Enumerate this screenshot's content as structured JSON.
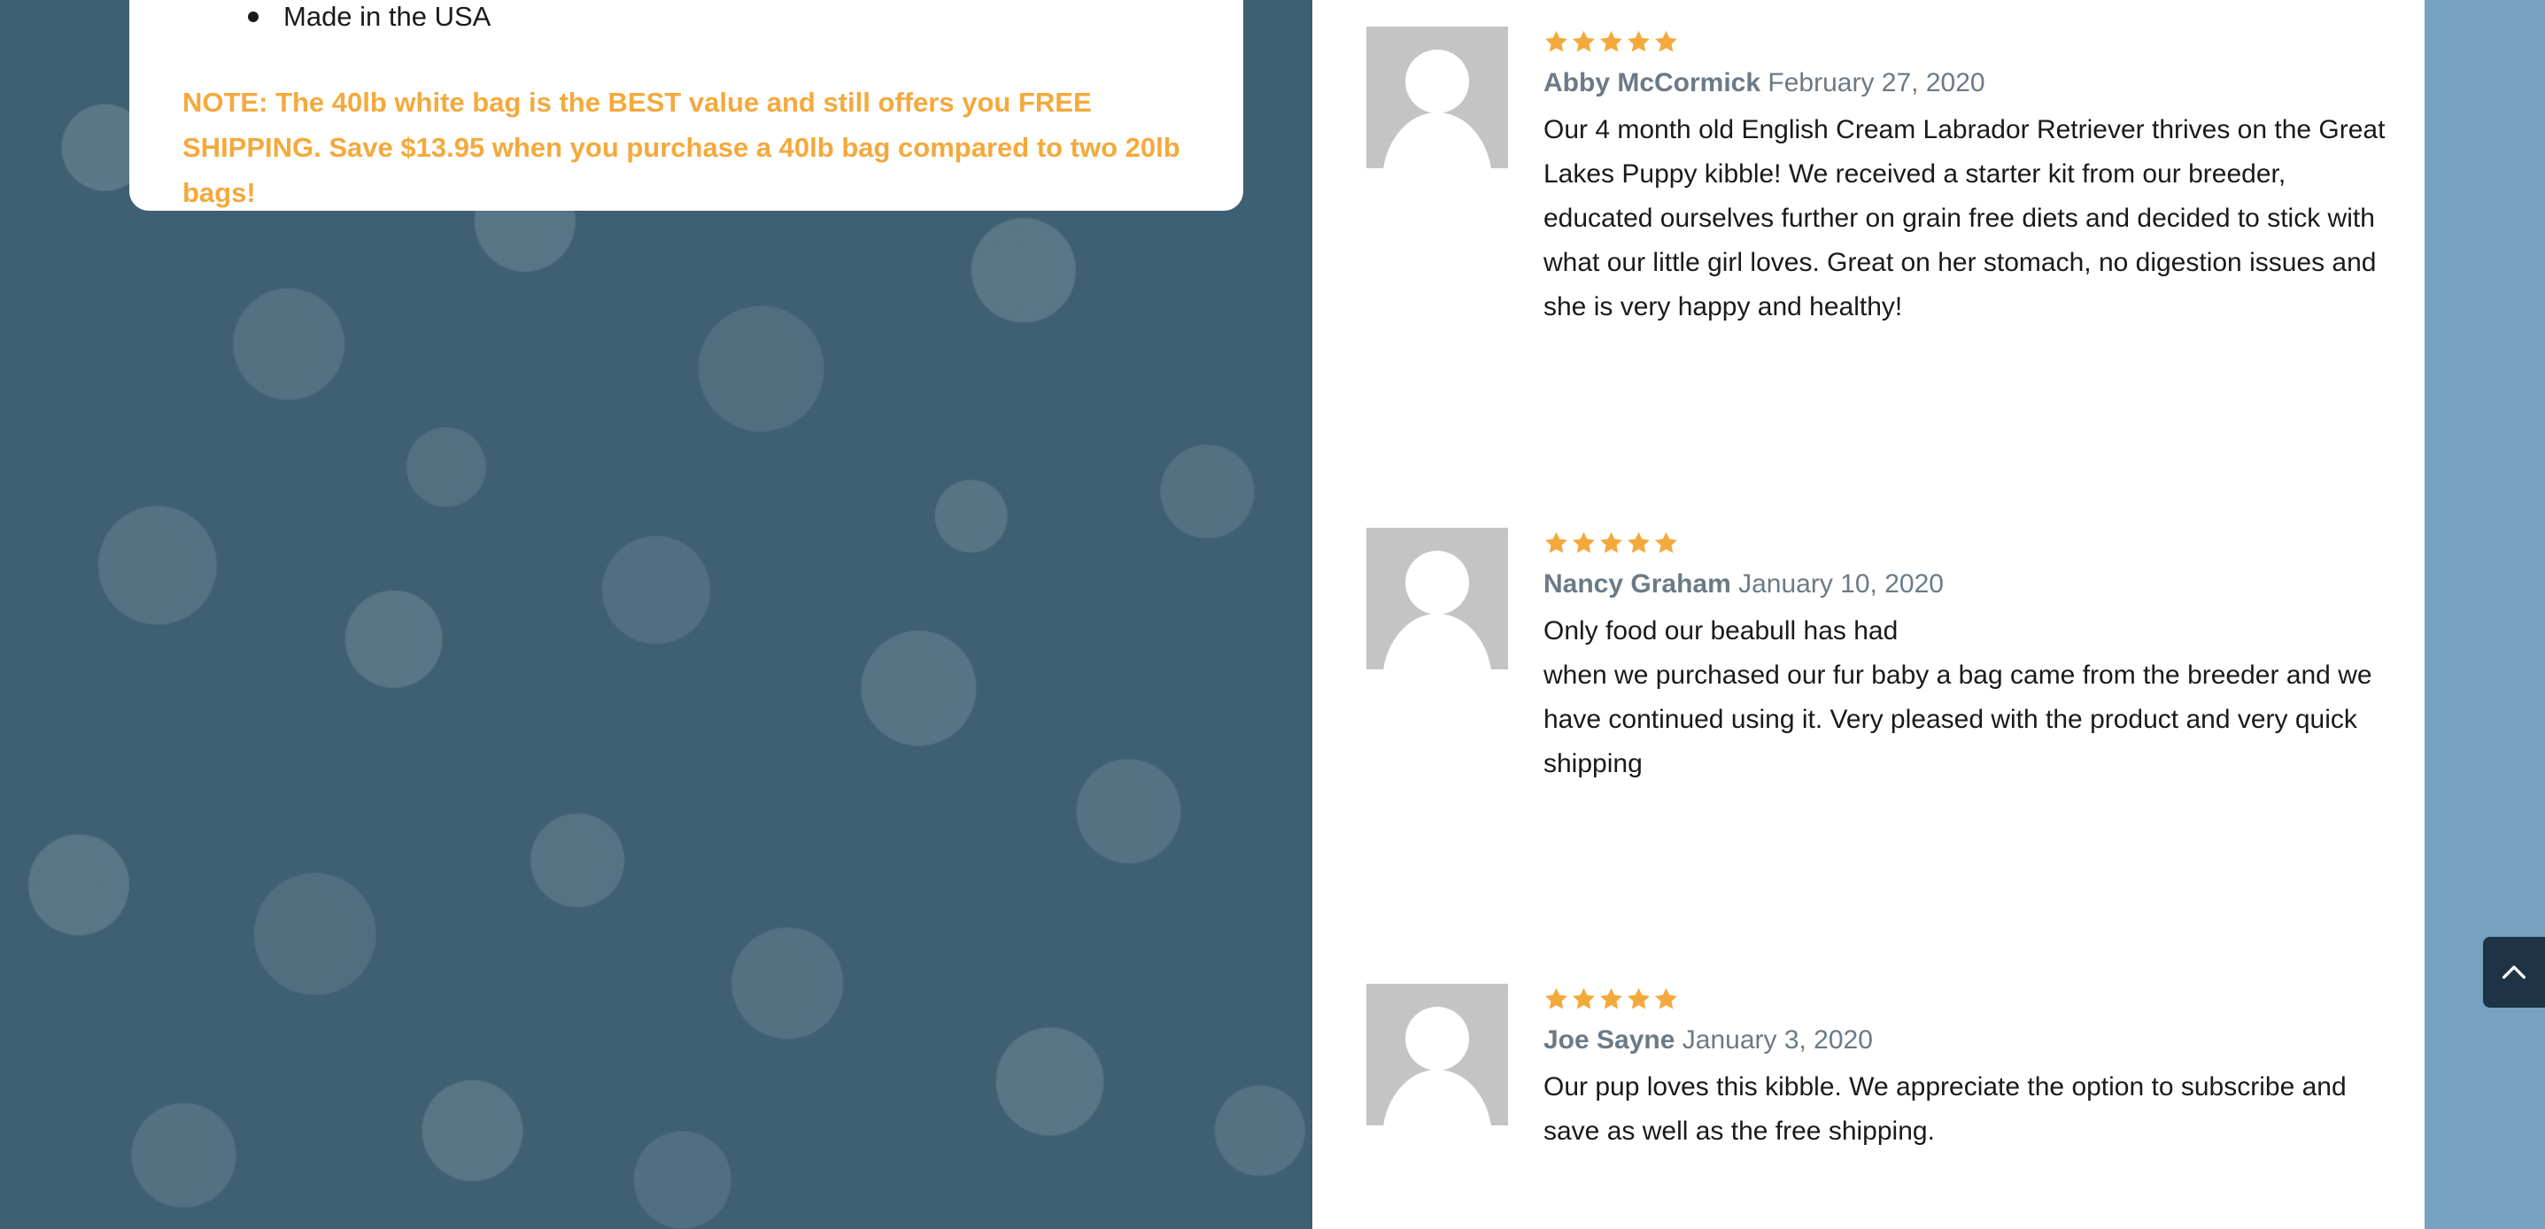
{
  "product": {
    "features": [
      "Made in the USA"
    ],
    "note": "NOTE: The 40lb white bag is the BEST value and still offers you FREE SHIPPING. Save $13.95 when you purchase a 40lb bag compared to two 20lb bags!"
  },
  "colors": {
    "accent_orange": "#f4a93c",
    "strip_blue": "#75a3bf",
    "author_gray": "#6b7a86"
  },
  "reviews": [
    {
      "rating": 5,
      "author": "Abby McCormick",
      "date": "February 27, 2020",
      "text": "Our 4 month old English Cream Labrador Retriever thrives on the Great Lakes Puppy kibble! We received a starter kit from our breeder, educated ourselves further on grain free diets and decided to stick with what our little girl loves. Great on her stomach, no digestion issues and she is very happy and healthy!"
    },
    {
      "rating": 5,
      "author": "Nancy Graham",
      "date": "January 10, 2020",
      "text_line1": "Only food our beabull has had",
      "text": "when we purchased our fur baby a bag came from the breeder and we have continued using it. Very pleased with the product and very quick shipping"
    },
    {
      "rating": 5,
      "author": "Joe Sayne",
      "date": "January 3, 2020",
      "text": "Our pup loves this kibble. We appreciate the option to subscribe and save as well as the free shipping."
    }
  ],
  "icons": {
    "star": "star-icon",
    "avatar": "default-avatar-icon",
    "back_to_top": "chevron-up-icon"
  }
}
